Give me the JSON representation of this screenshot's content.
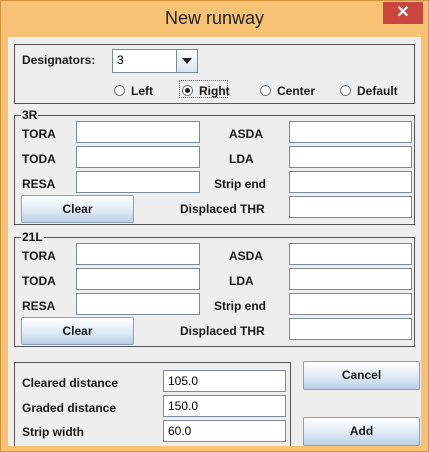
{
  "window": {
    "title": "New runway",
    "close_glyph": "✕"
  },
  "designators": {
    "label": "Designators:",
    "value": "3",
    "radios": [
      {
        "label": "Left",
        "selected": false
      },
      {
        "label": "Right",
        "selected": true
      },
      {
        "label": "Center",
        "selected": false
      },
      {
        "label": "Default",
        "selected": false
      }
    ]
  },
  "runway_a": {
    "legend": "3R",
    "tora": "TORA",
    "toda": "TODA",
    "resa": "RESA",
    "asda": "ASDA",
    "lda": "LDA",
    "strip_end": "Strip end",
    "displaced_thr": "Displaced THR",
    "clear": "Clear"
  },
  "runway_b": {
    "legend": "21L",
    "tora": "TORA",
    "toda": "TODA",
    "resa": "RESA",
    "asda": "ASDA",
    "lda": "LDA",
    "strip_end": "Strip end",
    "displaced_thr": "Displaced THR",
    "clear": "Clear"
  },
  "bottom": {
    "cleared_distance_label": "Cleared distance",
    "cleared_distance": "105.0",
    "graded_distance_label": "Graded distance",
    "graded_distance": "150.0",
    "strip_width_label": "Strip width",
    "strip_width": "60.0"
  },
  "actions": {
    "cancel": "Cancel",
    "add": "Add"
  }
}
